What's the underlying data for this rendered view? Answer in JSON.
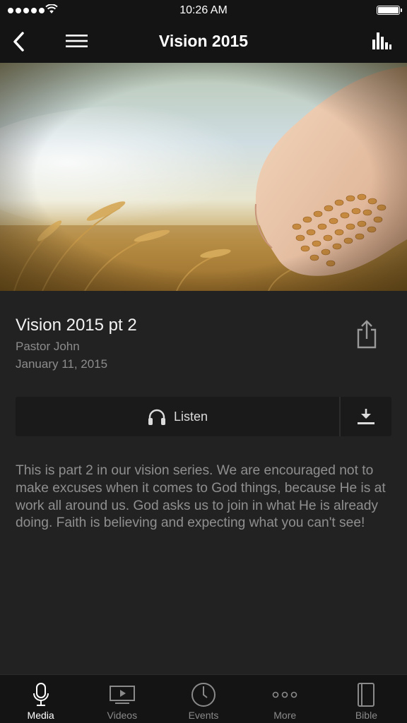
{
  "status_bar": {
    "time": "10:26 AM"
  },
  "nav": {
    "title": "Vision 2015"
  },
  "sermon": {
    "title": "Vision 2015 pt 2",
    "speaker": "Pastor John",
    "date": "January 11, 2015",
    "listen_label": "Listen",
    "description": "This is part 2 in our vision series. We are encouraged not to make excuses when it comes to God things, because He is at work all around us. God asks us to join in what He is already doing. Faith is believing and expecting what you can't see!"
  },
  "tabs": [
    {
      "label": "Media",
      "icon": "microphone-icon",
      "active": true
    },
    {
      "label": "Videos",
      "icon": "video-icon",
      "active": false
    },
    {
      "label": "Events",
      "icon": "clock-icon",
      "active": false
    },
    {
      "label": "More",
      "icon": "more-dots-icon",
      "active": false
    },
    {
      "label": "Bible",
      "icon": "book-icon",
      "active": false
    }
  ],
  "colors": {
    "background": "#222222",
    "bar": "#141414",
    "button": "#1a1a1a",
    "muted_text": "#8c8c8c"
  }
}
